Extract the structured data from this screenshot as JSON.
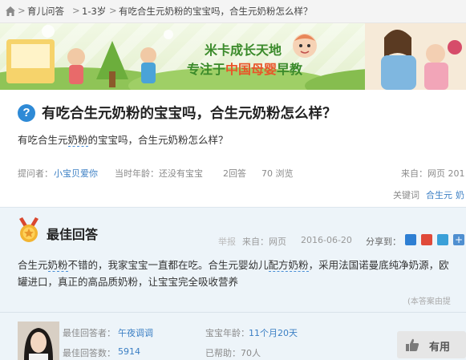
{
  "breadcrumb": {
    "items": [
      "育儿问答",
      "1-3岁",
      "有吃合生元奶粉的宝宝吗，合生元奶粉怎么样？"
    ],
    "separator": ">"
  },
  "banner": {
    "slogan_line1": "米卡成长天地",
    "slogan_line2_prefix": "专注于",
    "slogan_line2_highlight": "中国母婴",
    "slogan_line2_suffix": "早教"
  },
  "question": {
    "title": "有吃合生元奶粉的宝宝吗，合生元奶粉怎么样？",
    "body_prefix": "有吃合生元",
    "body_keyword": "奶粉",
    "body_suffix": "的宝宝吗，合生元奶粉怎么样？",
    "asker_label": "提问者：",
    "asker_name": "小宝贝爱你",
    "age_label": "当时年龄：还没有宝宝",
    "answers": "2回答",
    "views": "70 浏览",
    "source": "来自：网页 201",
    "keywords_label": "关键词",
    "keywords": [
      "合生元",
      "奶"
    ]
  },
  "best_answer": {
    "heading": "最佳回答",
    "report": "举报",
    "source": "来自：网页",
    "date": "2016-06-20",
    "share_label": "分享到：",
    "text_parts": [
      "合生元",
      "奶粉",
      "不错的，我家宝宝一直都在吃。合生元婴幼儿",
      "配方奶粉",
      "，采用法国诺曼底纯净奶源，欧",
      "罐进口，真正的高品质奶粉，让宝宝完全吸收营养"
    ],
    "from_note": "(本答案由提",
    "answerer_label": "最佳回答者：",
    "answerer_name": "午夜调调",
    "answers_count_label": "最佳回答数：",
    "answers_count": "5914",
    "baby_age_label": "宝宝年龄：",
    "baby_age": "11个月20天",
    "helped": "已帮助：70人",
    "useful_label": "有用"
  },
  "colors": {
    "accent_blue": "#3b7fc4",
    "banner_green": "#3a8a2a",
    "highlight_orange": "#e8562a"
  }
}
